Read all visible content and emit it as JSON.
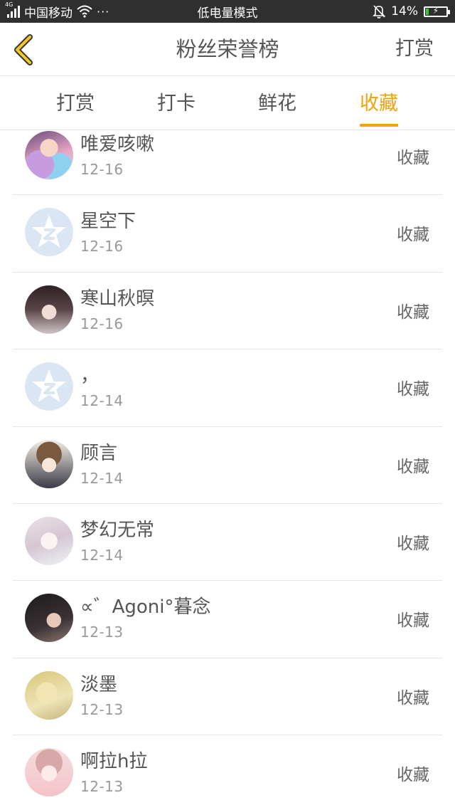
{
  "status_bar": {
    "network_badge": "4G",
    "carrier": "中国移动",
    "more": "···",
    "mode": "低电量模式",
    "battery_percent": "14%",
    "battery_level": 0.14
  },
  "header": {
    "title": "粉丝荣誉榜",
    "right_action": "打赏"
  },
  "tabs": [
    {
      "label": "打赏",
      "active": false
    },
    {
      "label": "打卡",
      "active": false
    },
    {
      "label": "鲜花",
      "active": false
    },
    {
      "label": "收藏",
      "active": true
    }
  ],
  "colors": {
    "accent": "#f0a30c",
    "statusbar": "#2f2f2f",
    "default_avatar": "#dbe6f4"
  },
  "fans": [
    {
      "name": "唯爱咳嗽",
      "date": "12-16",
      "type": "收藏",
      "avatar": "anime-girl-colorful"
    },
    {
      "name": "星空下",
      "date": "12-16",
      "type": "收藏",
      "avatar": "default-star-icon"
    },
    {
      "name": "寒山秋暝",
      "date": "12-16",
      "type": "收藏",
      "avatar": "dark-hair-portrait"
    },
    {
      "name": "，",
      "date": "12-14",
      "type": "收藏",
      "avatar": "default-star-icon"
    },
    {
      "name": "顾言",
      "date": "12-14",
      "type": "收藏",
      "avatar": "anime-girl-brown"
    },
    {
      "name": "梦幻无常",
      "date": "12-14",
      "type": "收藏",
      "avatar": "anime-girl-white"
    },
    {
      "name": "∝゛Agoni°暮念",
      "date": "12-13",
      "type": "收藏",
      "avatar": "dark-portrait"
    },
    {
      "name": "淡墨",
      "date": "12-13",
      "type": "收藏",
      "avatar": "sepia-sketch"
    },
    {
      "name": "啊拉h拉",
      "date": "12-13",
      "type": "收藏",
      "avatar": "anime-girl-pink"
    }
  ]
}
